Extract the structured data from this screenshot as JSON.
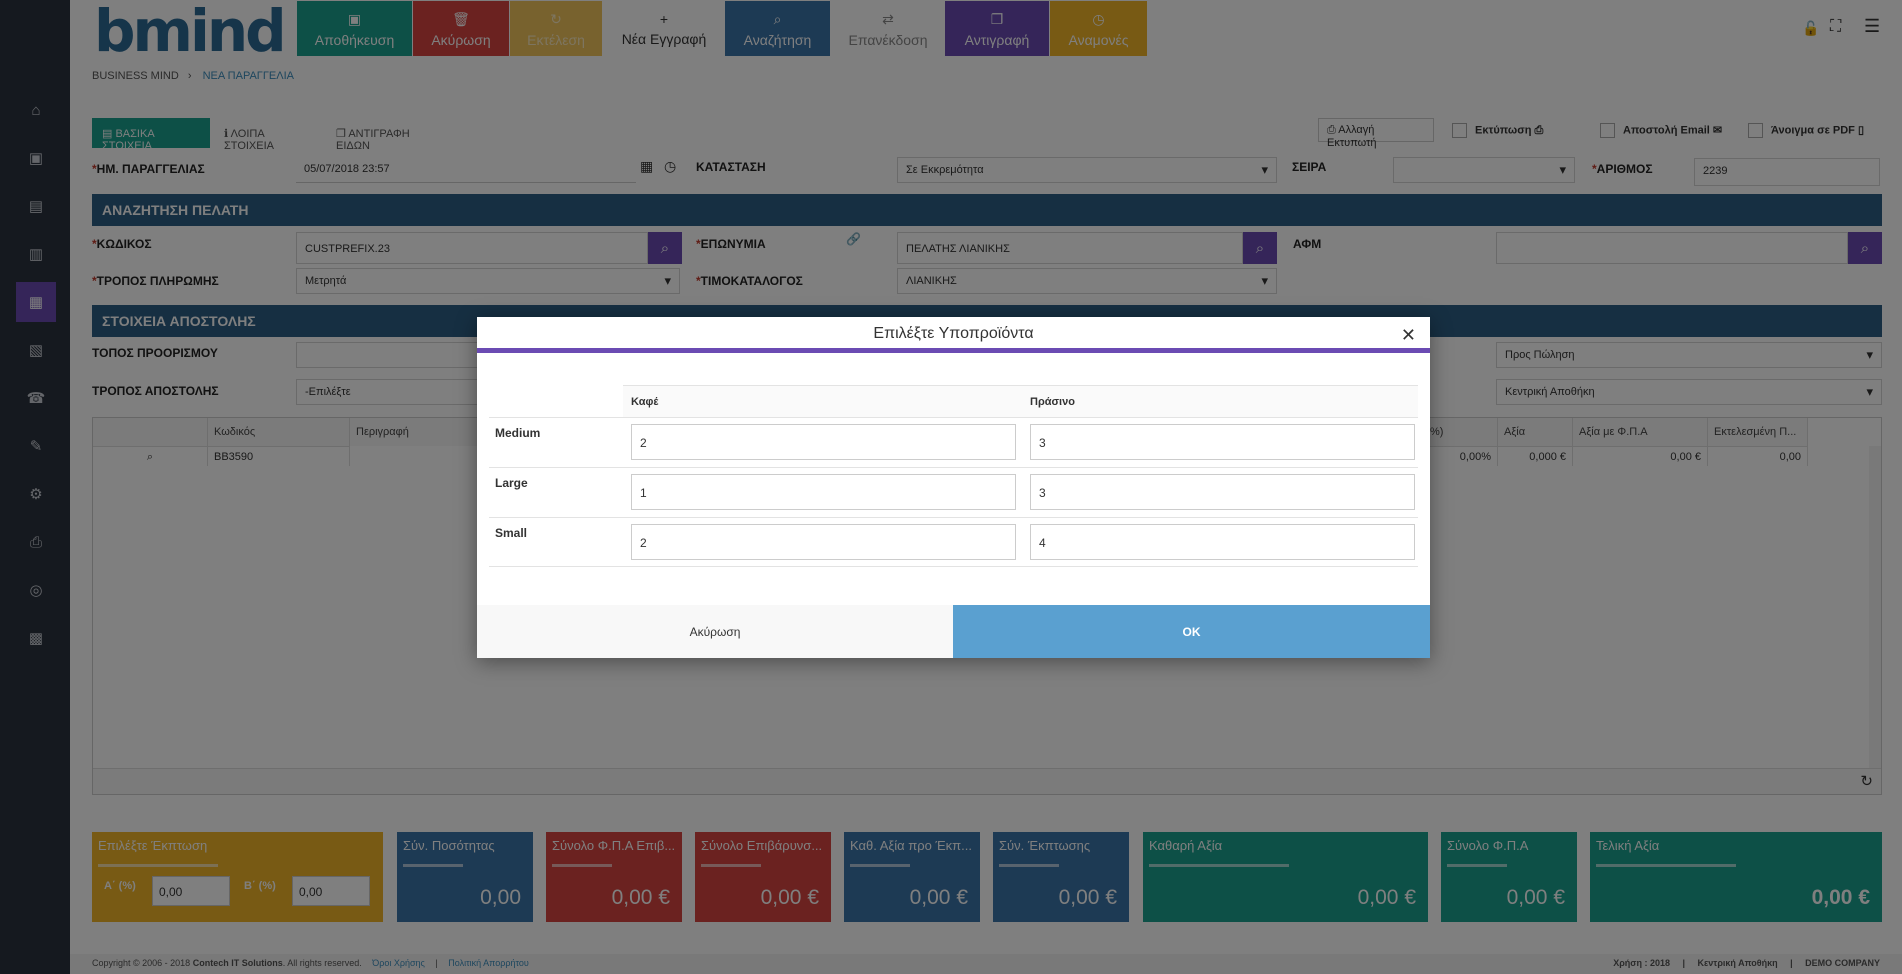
{
  "app": {
    "logo": "bmind"
  },
  "toolbar": {
    "save": "Αποθήκευση",
    "cancel": "Ακύρωση",
    "execute": "Εκτέλεση",
    "new": "Νέα Εγγραφή",
    "search": "Αναζήτηση",
    "reissue": "Επανέκδοση",
    "copy": "Αντιγραφή",
    "pending": "Αναμονές"
  },
  "breadcrumb": {
    "root": "BUSINESS MIND",
    "separator": "›",
    "current": "ΝΕΑ ΠΑΡΑΓΓΕΛΙΑ"
  },
  "tabs": [
    "ΒΑΣΙΚΑ ΣΤΟΙΧΕΙΑ",
    "ΛΟΙΠΑ ΣΤΟΙΧΕΙΑ",
    "ΑΝΤΙΓΡΑΦΗ ΕΙΔΩΝ"
  ],
  "print_options": {
    "change_printer": "Αλλαγή Εκτυπωτή",
    "print": "Εκτύπωση",
    "send_email": "Αποστολή Email",
    "open_pdf": "Άνοιγμα σε PDF"
  },
  "header_fields": {
    "order_date_label": "ΗΜ. ΠΑΡΑΓΓΕΛΙΑΣ",
    "order_date": "05/07/2018 23:57",
    "status_label": "ΚΑΤΑΣΤΑΣΗ",
    "status": "Σε Εκκρεμότητα",
    "series_label": "ΣΕΙΡΑ",
    "series": "",
    "number_label": "ΑΡΙΘΜΟΣ",
    "number": "2239"
  },
  "customer": {
    "section_title": "ΑΝΑΖΗΤΗΣΗ ΠΕΛΑΤΗ",
    "code_label": "ΚΩΔΙΚΟΣ",
    "code": "CUSTPREFIX.23",
    "name_label": "ΕΠΩΝΥΜΙΑ",
    "name": "ΠΕΛΑΤΗΣ ΛΙΑΝΙΚΗΣ",
    "vat_label": "ΑΦΜ",
    "vat": "",
    "payment_label": "ΤΡΟΠΟΣ ΠΛΗΡΩΜΗΣ",
    "payment": "Μετρητά",
    "pricelist_label": "ΤΙΜΟΚΑΤΑΛΟΓΟΣ",
    "pricelist": "ΛΙΑΝΙΚΗΣ"
  },
  "shipping": {
    "section_title": "ΣΤΟΙΧΕΙΑ ΑΠΟΣΤΟΛΗΣ",
    "destination_label": "ΤΟΠΟΣ ΠΡΟΟΡΙΣΜΟΥ",
    "method_label": "ΤΡΟΠΟΣ ΑΠΟΣΤΟΛΗΣ",
    "method": "-Επιλέξτε",
    "purpose": "Προς Πώληση",
    "warehouse": "Κεντρική Αποθήκη"
  },
  "grid": {
    "headers": [
      "Κωδικός",
      "Περιγραφή",
      "%)",
      "Αξία",
      "Αξία με Φ.Π.Α",
      "Εκτελεσμένη Π..."
    ],
    "row": {
      "code": "BB3590",
      "pct": "0,00%",
      "value": "0,000 €",
      "value_vat": "0,00 €",
      "executed": "0,00"
    }
  },
  "discount": {
    "title": "Επιλέξτε Έκπτωση",
    "a_label": "Α΄ (%)",
    "a_value": "0,00",
    "b_label": "Β΄ (%)",
    "b_value": "0,00"
  },
  "totals": [
    {
      "label": "Σύν. Ποσότητας",
      "value": "0,00",
      "color": "#3a74a8"
    },
    {
      "label": "Σύνολο Φ.Π.Α Επιβ...",
      "value": "0,00 €",
      "color": "#d64541"
    },
    {
      "label": "Σύνολο Επιβάρυνσ...",
      "value": "0,00 €",
      "color": "#d64541"
    },
    {
      "label": "Καθ. Αξία προ Έκπ...",
      "value": "0,00 €",
      "color": "#3a74a8"
    },
    {
      "label": "Σύν. Έκπτωσης",
      "value": "0,00 €",
      "color": "#3a74a8"
    },
    {
      "label": "Καθαρή Αξία",
      "value": "0,00 €",
      "color": "#1aa08e"
    },
    {
      "label": "Σύνολο Φ.Π.Α",
      "value": "0,00 €",
      "color": "#1aa08e"
    },
    {
      "label": "Τελική Αξία",
      "value": "0,00 €",
      "color": "#1aa08e"
    }
  ],
  "footer": {
    "copyright": "Copyright © 2006 - 2018",
    "company": "Contech IT Solutions",
    "rights": ". All rights reserved.",
    "terms": "Όροι Χρήσης",
    "privacy": "Πολιτική Απορρήτου",
    "year": "Χρήση : 2018",
    "warehouse": "Κεντρική Αποθήκη",
    "demo": "DEMO COMPANY"
  },
  "modal": {
    "title": "Επιλέξτε Υποπροϊόντα",
    "columns": [
      "Καφέ",
      "Πράσινο"
    ],
    "rows": [
      {
        "label": "Medium",
        "values": [
          "2",
          "3"
        ]
      },
      {
        "label": "Large",
        "values": [
          "1",
          "3"
        ]
      },
      {
        "label": "Small",
        "values": [
          "2",
          "4"
        ]
      }
    ],
    "cancel": "Ακύρωση",
    "ok": "OK"
  }
}
